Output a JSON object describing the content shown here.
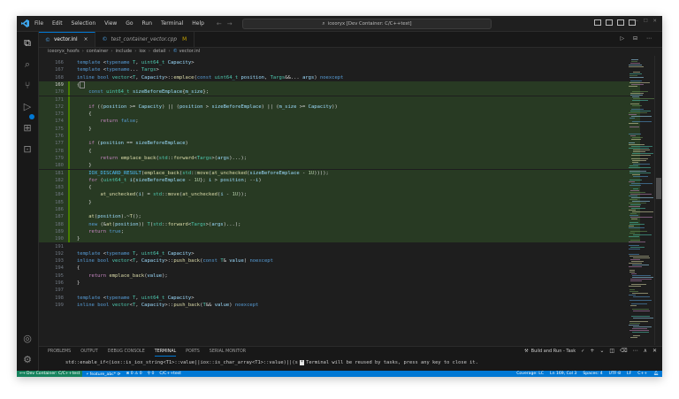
{
  "titlebar": {
    "menu": [
      "File",
      "Edit",
      "Selection",
      "View",
      "Go",
      "Run",
      "Terminal",
      "Help"
    ],
    "command_center": "iceoryx [Dev Container: C/C++test]"
  },
  "tabs": [
    {
      "label": "vector.inl",
      "close": "×",
      "active": true
    },
    {
      "label": "test_container_vector.cpp",
      "modified": "M",
      "active": false
    }
  ],
  "breadcrumb": [
    "iceoryx_hoofs",
    "container",
    "include",
    "iox",
    "detail",
    "vector.inl"
  ],
  "editor": {
    "lines": [
      {
        "n": "166",
        "html": "<span class=\"kw\">template</span> &lt;<span class=\"kw\">typename</span> <span class=\"ty\">T</span>, <span class=\"ty\">uint64_t</span> <span class=\"va\">Capacity</span>&gt;",
        "diff": false
      },
      {
        "n": "167",
        "html": "<span class=\"kw\">template</span> &lt;<span class=\"kw\">typename</span>... <span class=\"ty\">Targs</span>&gt;",
        "diff": false
      },
      {
        "n": "168",
        "html": "<span class=\"kw\">inline</span> <span class=\"kw\">bool</span> <span class=\"ty\">vector</span>&lt;<span class=\"ty\">T</span>, <span class=\"va\">Capacity</span>&gt;::<span class=\"fn\">emplace</span>(<span class=\"kw\">const</span> <span class=\"ty\">uint64_t</span> <span class=\"va\">position</span>, <span class=\"ty\">Targs</span>&amp;&amp;... <span class=\"va\">args</span>) <span class=\"kw\">noexcept</span>",
        "diff": false
      },
      {
        "n": "169",
        "html": "{<span class=\"cursorbox\"></span>",
        "diff": true,
        "cur": true
      },
      {
        "n": "170",
        "html": "    <span class=\"kw\">const</span> <span class=\"ty\">uint64_t</span> <span class=\"va\">sizeBeforeEmplace</span>{<span class=\"va\">m_size</span>};",
        "diff": true
      },
      {
        "n": "171",
        "html": "",
        "diff": true
      },
      {
        "n": "172",
        "html": "    <span class=\"ct\">if</span> ((<span class=\"va\">position</span> &gt;= <span class=\"va\">Capacity</span>) || (<span class=\"va\">position</span> &gt; <span class=\"va\">sizeBeforeEmplace</span>) || (<span class=\"va\">m_size</span> &gt;= <span class=\"va\">Capacity</span>))",
        "diff": true
      },
      {
        "n": "173",
        "html": "    {",
        "diff": true
      },
      {
        "n": "174",
        "html": "        <span class=\"ct\">return</span> <span class=\"kw\">false</span>;",
        "diff": true
      },
      {
        "n": "175",
        "html": "    }",
        "diff": true
      },
      {
        "n": "176",
        "html": "",
        "diff": true
      },
      {
        "n": "177",
        "html": "    <span class=\"ct\">if</span> (<span class=\"va\">position</span> == <span class=\"va\">sizeBeforeEmplace</span>)",
        "diff": true
      },
      {
        "n": "178",
        "html": "    {",
        "diff": true
      },
      {
        "n": "179",
        "html": "        <span class=\"ct\">return</span> <span class=\"fn\">emplace_back</span>(<span class=\"ty\">std</span>::<span class=\"fn\">forward</span>&lt;<span class=\"ty\">Targs</span>&gt;(<span class=\"va\">args</span>)...);",
        "diff": true
      },
      {
        "n": "180",
        "html": "    }",
        "diff": true
      },
      {
        "n": "181",
        "html": "    <span class=\"mac\">IOX_DISCARD_RESULT</span>(<span class=\"fn\">emplace_back</span>(<span class=\"ty\">std</span>::<span class=\"fn\">move</span>(<span class=\"fn\">at_unchecked</span>(<span class=\"va\">sizeBeforeEmplace</span> - <span class=\"nu\">1U</span>))));",
        "diff": true
      },
      {
        "n": "182",
        "html": "    <span class=\"ct\">for</span> (<span class=\"ty\">uint64_t</span> <span class=\"va\">i</span>{<span class=\"va\">sizeBeforeEmplace</span> - <span class=\"nu\">1U</span>}; <span class=\"va\">i</span> &gt; <span class=\"va\">position</span>; --<span class=\"va\">i</span>)",
        "diff": true
      },
      {
        "n": "183",
        "html": "    {",
        "diff": true
      },
      {
        "n": "184",
        "html": "        <span class=\"fn\">at_unchecked</span>(<span class=\"va\">i</span>) = <span class=\"ty\">std</span>::<span class=\"fn\">move</span>(<span class=\"fn\">at_unchecked</span>(<span class=\"va\">i</span> - <span class=\"nu\">1U</span>));",
        "diff": true
      },
      {
        "n": "185",
        "html": "    }",
        "diff": true
      },
      {
        "n": "186",
        "html": "",
        "diff": true
      },
      {
        "n": "187",
        "html": "    <span class=\"fn\">at</span>(<span class=\"va\">position</span>).~<span class=\"fn\">T</span>();",
        "diff": true
      },
      {
        "n": "188",
        "html": "    <span class=\"kw\">new</span> (&amp;<span class=\"fn\">at</span>(<span class=\"va\">position</span>)) <span class=\"ty\">T</span>(<span class=\"ty\">std</span>::<span class=\"fn\">forward</span>&lt;<span class=\"ty\">Targs</span>&gt;(<span class=\"va\">args</span>)...);",
        "diff": true
      },
      {
        "n": "189",
        "html": "    <span class=\"ct\">return</span> <span class=\"kw\">true</span>;",
        "diff": true
      },
      {
        "n": "190",
        "html": "}",
        "diff": true
      },
      {
        "n": "191",
        "html": "",
        "diff": false
      },
      {
        "n": "192",
        "html": "<span class=\"kw\">template</span> &lt;<span class=\"kw\">typename</span> <span class=\"ty\">T</span>, <span class=\"ty\">uint64_t</span> <span class=\"va\">Capacity</span>&gt;",
        "diff": false
      },
      {
        "n": "193",
        "html": "<span class=\"kw\">inline</span> <span class=\"kw\">bool</span> <span class=\"ty\">vector</span>&lt;<span class=\"ty\">T</span>, <span class=\"va\">Capacity</span>&gt;::<span class=\"fn\">push_back</span>(<span class=\"kw\">const</span> <span class=\"ty\">T</span>&amp; <span class=\"va\">value</span>) <span class=\"kw\">noexcept</span>",
        "diff": false
      },
      {
        "n": "194",
        "html": "{",
        "diff": false
      },
      {
        "n": "195",
        "html": "    <span class=\"ct\">return</span> <span class=\"fn\">emplace_back</span>(<span class=\"va\">value</span>);",
        "diff": false
      },
      {
        "n": "196",
        "html": "}",
        "diff": false
      },
      {
        "n": "197",
        "html": "",
        "diff": false
      },
      {
        "n": "198",
        "html": "<span class=\"kw\">template</span> &lt;<span class=\"kw\">typename</span> <span class=\"ty\">T</span>, <span class=\"ty\">uint64_t</span> <span class=\"va\">Capacity</span>&gt;",
        "diff": false
      },
      {
        "n": "199",
        "html": "<span class=\"kw\">inline</span> <span class=\"kw\">bool</span> <span class=\"ty\">vector</span>&lt;<span class=\"ty\">T</span>, <span class=\"va\">Capacity</span>&gt;::<span class=\"fn\">push_back</span>(<span class=\"ty\">T</span>&amp;&amp; <span class=\"va\">value</span>) <span class=\"kw\">noexcept</span>",
        "diff": false
      }
    ]
  },
  "panel": {
    "tabs": [
      "PROBLEMS",
      "OUTPUT",
      "DEBUG CONSOLE",
      "TERMINAL",
      "PORTS",
      "SERIAL MONITOR"
    ],
    "active_tab": "TERMINAL",
    "task_label": "Build and Run - Task",
    "terminal_prefix": "std::enable_if<(iox::is_iox_string<T1>::value||iox::is_char_array<T1>::value)||(s",
    "terminal_star": "*",
    "terminal_message": "Terminal will be reused by tasks, press any key to close it."
  },
  "statusbar": {
    "remote": "Dev Container: C/C++test",
    "branch": "feature_abc*",
    "sync": "⟳",
    "problems": "⊗ 0 ⚠ 0",
    "ports": "⚲ 0",
    "language_hint": "C/C++test",
    "coverage": "Coverage: LC",
    "cursor": "Ln 169, Col 3",
    "spaces": "Spaces: 4",
    "encoding": "UTF-8",
    "eol": "LF",
    "language": "C++"
  },
  "colors": {
    "accent": "#0078d4",
    "diff_added": "#283a23",
    "remote": "#16825d"
  }
}
